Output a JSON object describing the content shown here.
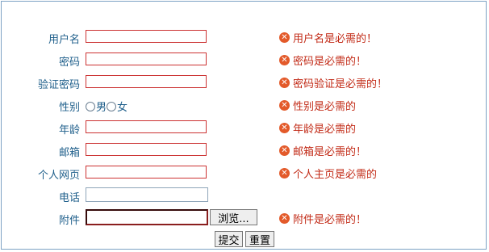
{
  "form": {
    "fields": [
      {
        "label": "用户名",
        "error": "用户名是必需的！"
      },
      {
        "label": "密码",
        "error": "密码是必需的！"
      },
      {
        "label": "验证密码",
        "error": "密码验证是必需的！"
      },
      {
        "label": "性别",
        "error": "性别是必需的",
        "options": [
          "男",
          "女"
        ]
      },
      {
        "label": "年龄",
        "error": "年龄是必需的"
      },
      {
        "label": "邮箱",
        "error": "邮箱是必需的！"
      },
      {
        "label": "个人网页",
        "error": "个人主页是必需的"
      },
      {
        "label": "电话"
      },
      {
        "label": "附件",
        "error": "附件是必需的！"
      }
    ],
    "browse_label": "浏览...",
    "submit_label": "提交",
    "reset_label": "重置",
    "error_icon": "x-circle-icon"
  },
  "colors": {
    "label": "#1f5f8b",
    "error_text": "#c22a16",
    "error_border": "#cc3333",
    "error_icon": "#e35a2a",
    "frame_border": "#7da2c4"
  }
}
